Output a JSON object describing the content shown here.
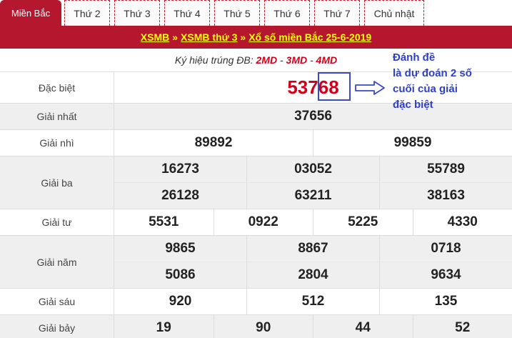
{
  "tabs": [
    {
      "label": "Miền Bắc",
      "active": true
    },
    {
      "label": "Thứ 2"
    },
    {
      "label": "Thứ 3"
    },
    {
      "label": "Thứ 4"
    },
    {
      "label": "Thứ 5"
    },
    {
      "label": "Thứ 6"
    },
    {
      "label": "Thứ 7"
    },
    {
      "label": "Chủ nhật"
    }
  ],
  "breadcrumb": {
    "link1": "XSMB",
    "sep": "»",
    "link2": "XSMB thứ 3",
    "link3": "Xổ số miền Bắc 25-6-2019"
  },
  "codes": {
    "prefix": "Ký hiệu trúng ĐB:",
    "c1": "2MD",
    "c2": "3MD",
    "c3": "4MD",
    "dash": " - "
  },
  "prizes": {
    "db": {
      "label": "Đặc biệt",
      "value_start": "537",
      "value_end": "68"
    },
    "g1": {
      "label": "Giải nhất",
      "values": [
        "37656"
      ]
    },
    "g2": {
      "label": "Giải nhì",
      "values": [
        "89892",
        "99859"
      ]
    },
    "g3": {
      "label": "Giải ba",
      "values": [
        "16273",
        "03052",
        "55789",
        "26128",
        "63211",
        "38163"
      ]
    },
    "g4": {
      "label": "Giải tư",
      "values": [
        "5531",
        "0922",
        "5225",
        "4330"
      ]
    },
    "g5": {
      "label": "Giải năm",
      "values": [
        "9865",
        "8867",
        "0718",
        "5086",
        "2804",
        "9634"
      ]
    },
    "g6": {
      "label": "Giải sáu",
      "values": [
        "920",
        "512",
        "135"
      ]
    },
    "g7": {
      "label": "Giải bảy",
      "values": [
        "19",
        "90",
        "44",
        "52"
      ]
    }
  },
  "annotation": {
    "lines": [
      "Đánh đề",
      "là dự đoán 2 số",
      "cuối của giải",
      "đặc biệt"
    ],
    "color": "#2f3fc6"
  },
  "colors": {
    "brand": "#b5172f",
    "link": "#ffff00",
    "special": "#d0021b"
  }
}
